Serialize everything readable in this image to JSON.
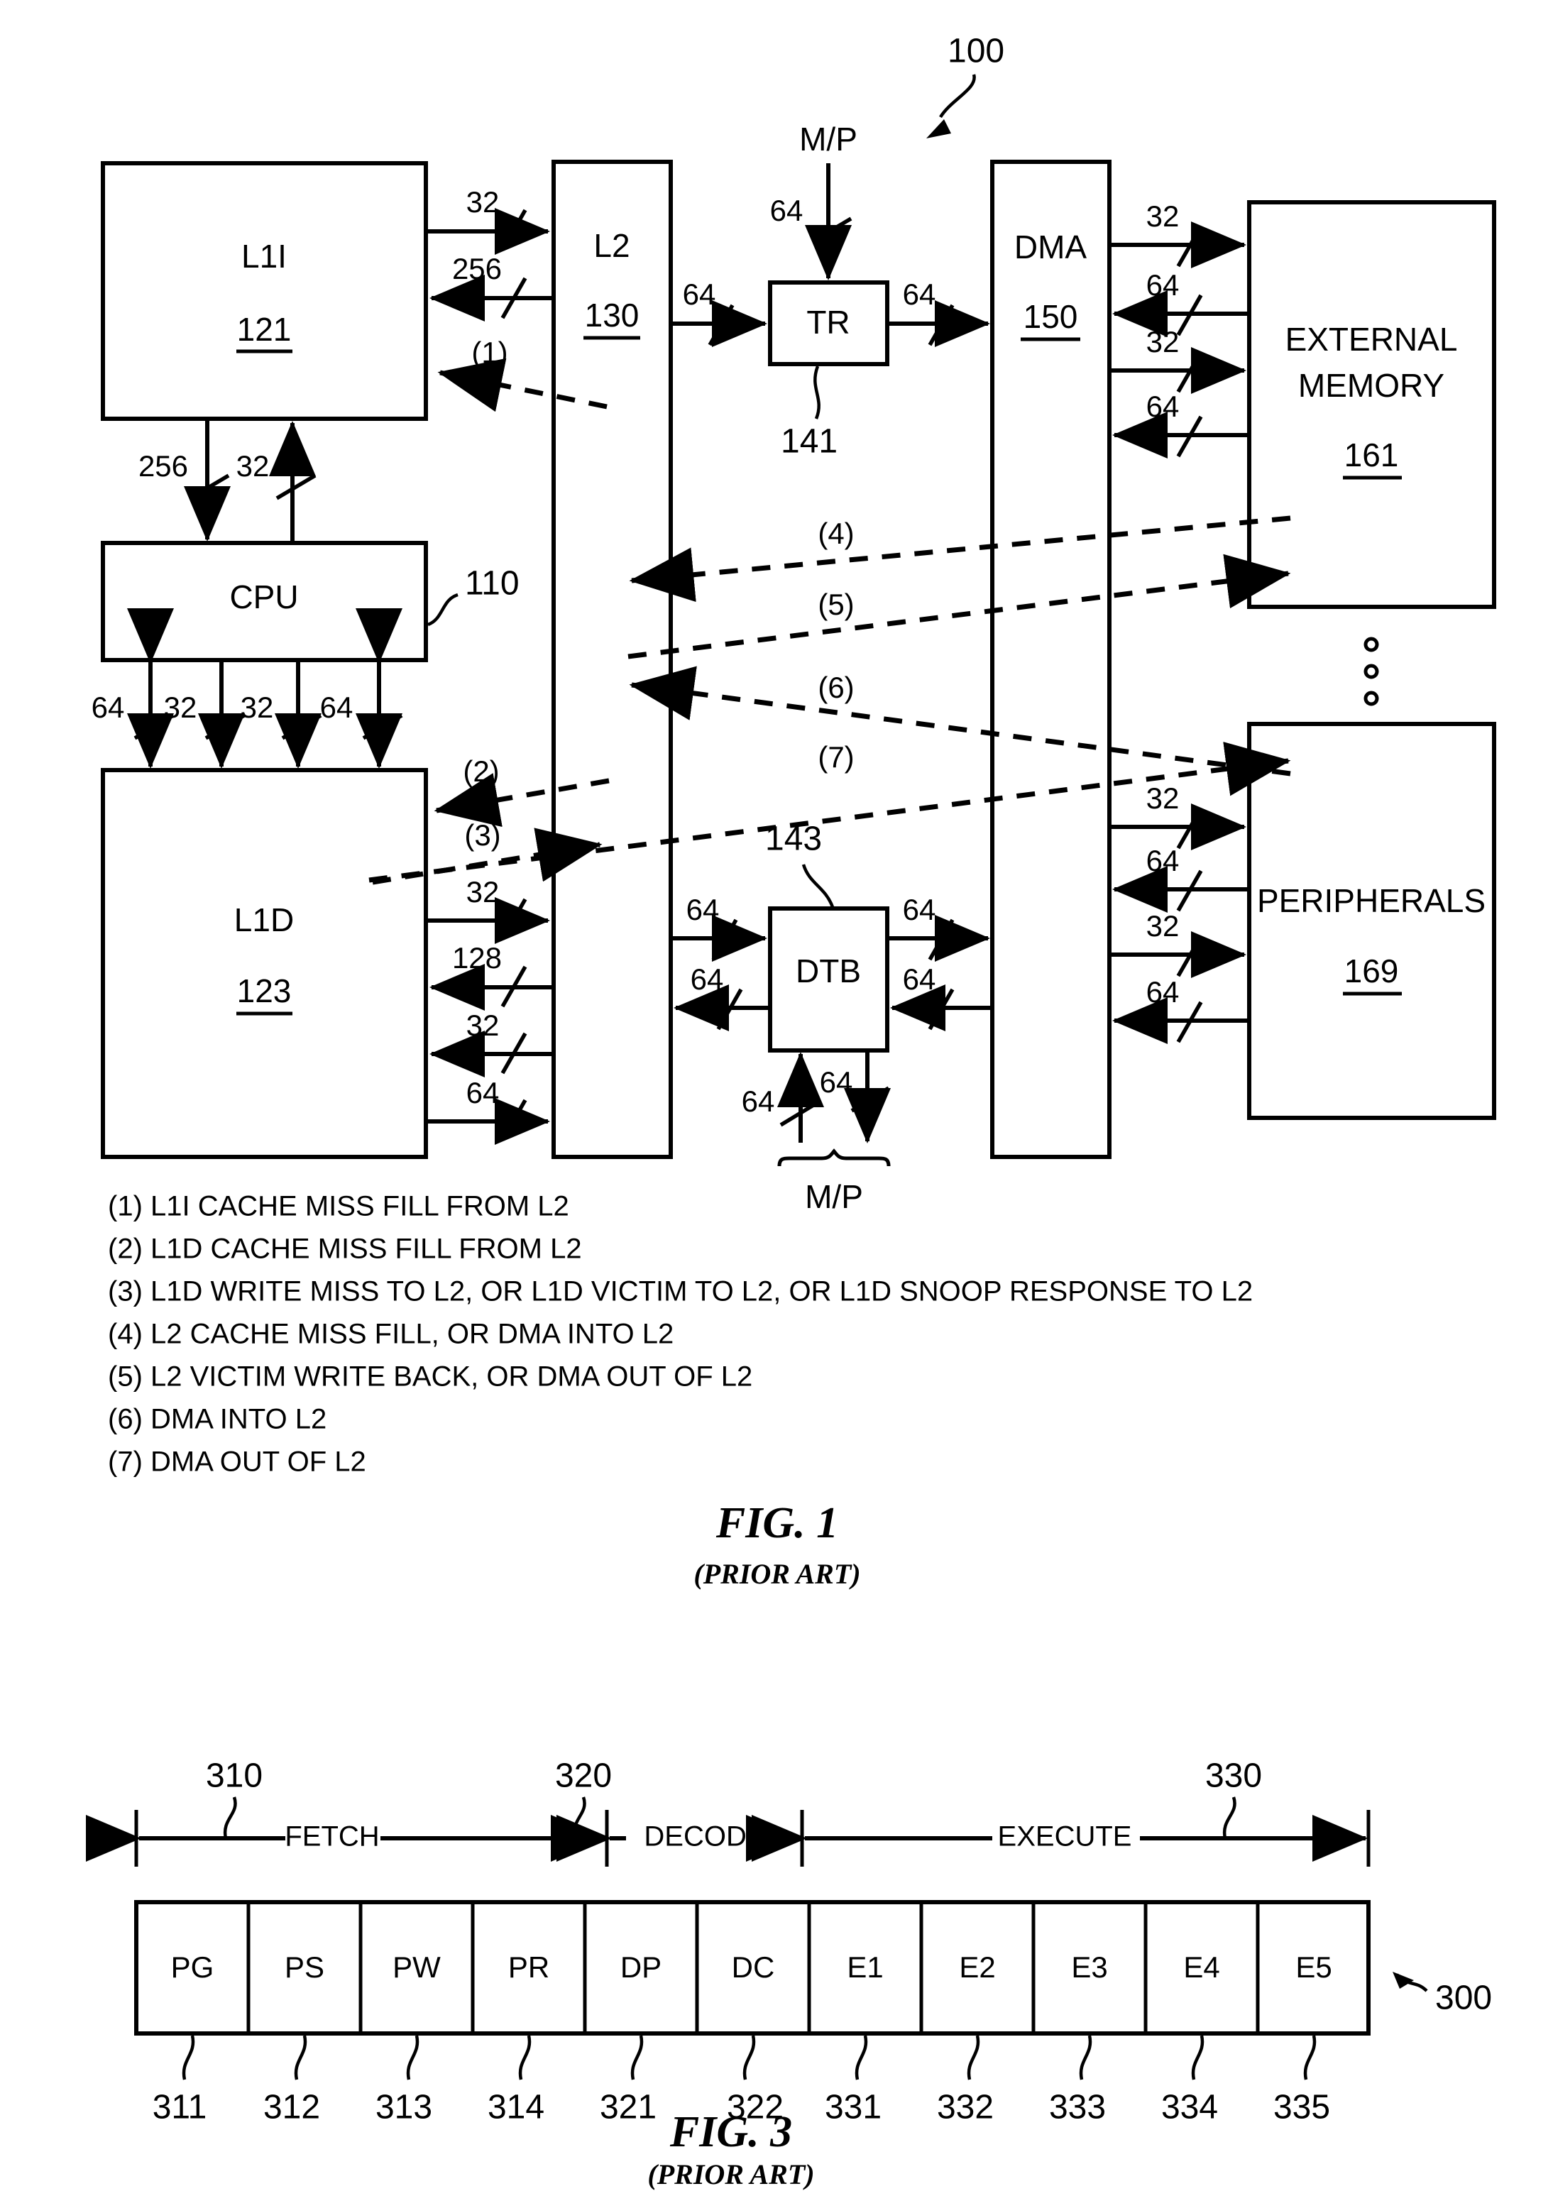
{
  "figure1": {
    "system_ref": "100",
    "blocks": [
      {
        "id": "l1i",
        "label": "L1I",
        "ref": "121"
      },
      {
        "id": "cpu",
        "label": "CPU",
        "ref": "110"
      },
      {
        "id": "l1d",
        "label": "L1D",
        "ref": "123"
      },
      {
        "id": "l2",
        "label": "L2",
        "ref": "130"
      },
      {
        "id": "tr",
        "label": "TR",
        "ref": "141"
      },
      {
        "id": "dtb",
        "label": "DTB",
        "ref": "143"
      },
      {
        "id": "dma",
        "label": "DMA",
        "ref": "150"
      },
      {
        "id": "extmem",
        "label_line1": "EXTERNAL",
        "label_line2": "MEMORY",
        "ref": "161"
      },
      {
        "id": "periph",
        "label": "PERIPHERALS",
        "ref": "169"
      }
    ],
    "mp_top_label": "M/P",
    "mp_bottom_label": "M/P",
    "bus_widths": {
      "l1i_to_l2": "32",
      "l2_to_l1i": "256",
      "l1i_to_cpu_256": "256",
      "cpu_to_l1i_32": "32",
      "cpu_l1d_a": "64",
      "cpu_l1d_b": "32",
      "cpu_l1d_c": "32",
      "cpu_l1d_d": "64",
      "l1d_to_l2_32": "32",
      "l2_to_l1d_128": "128",
      "l2_to_l1d_32": "32",
      "l1d_to_l2_64": "64",
      "l2_to_tr": "64",
      "tr_to_dma": "64",
      "mp_to_tr": "64",
      "l2_to_dtb": "64",
      "dtb_to_l2": "64",
      "dtb_to_dma": "64",
      "dma_to_dtb": "64",
      "dtb_mp_in": "64",
      "dtb_mp_out": "64",
      "dma_ext_1": "32",
      "dma_ext_2": "64",
      "dma_ext_3": "32",
      "dma_ext_4": "64",
      "dma_per_1": "32",
      "dma_per_2": "64",
      "dma_per_3": "32",
      "dma_per_4": "64"
    },
    "flow_markers": [
      "(1)",
      "(2)",
      "(3)",
      "(4)",
      "(5)",
      "(6)",
      "(7)"
    ],
    "legend": [
      "(1) L1I CACHE MISS FILL FROM L2",
      "(2) L1D CACHE MISS FILL FROM L2",
      "(3) L1D WRITE MISS TO L2, OR L1D VICTIM TO L2, OR L1D SNOOP RESPONSE TO L2",
      "(4) L2 CACHE MISS FILL, OR DMA INTO L2",
      "(5) L2 VICTIM WRITE BACK, OR DMA OUT OF L2",
      "(6) DMA INTO L2",
      "(7) DMA OUT OF L2"
    ],
    "caption": "FIG. 1",
    "caption_sub": "(PRIOR ART)"
  },
  "figure3": {
    "pipeline_ref": "300",
    "phases": [
      {
        "label": "FETCH",
        "ref": "310"
      },
      {
        "label": "DECODE",
        "ref": "320"
      },
      {
        "label": "EXECUTE",
        "ref": "330"
      }
    ],
    "stages": [
      {
        "label": "PG",
        "ref": "311"
      },
      {
        "label": "PS",
        "ref": "312"
      },
      {
        "label": "PW",
        "ref": "313"
      },
      {
        "label": "PR",
        "ref": "314"
      },
      {
        "label": "DP",
        "ref": "321"
      },
      {
        "label": "DC",
        "ref": "322"
      },
      {
        "label": "E1",
        "ref": "331"
      },
      {
        "label": "E2",
        "ref": "332"
      },
      {
        "label": "E3",
        "ref": "333"
      },
      {
        "label": "E4",
        "ref": "334"
      },
      {
        "label": "E5",
        "ref": "335"
      }
    ],
    "caption": "FIG. 3",
    "caption_sub": "(PRIOR ART)"
  }
}
